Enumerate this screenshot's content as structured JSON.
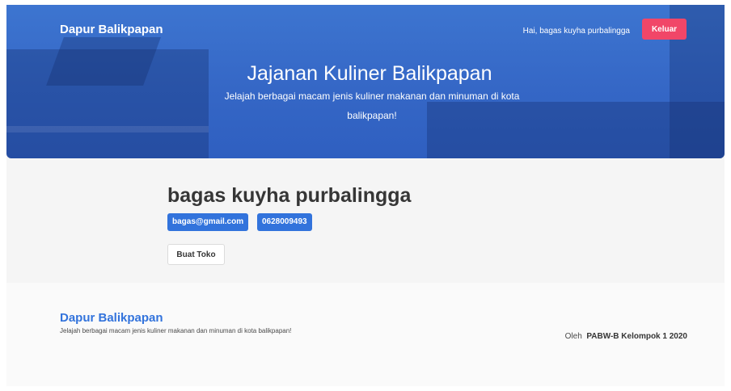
{
  "navbar": {
    "brand": "Dapur Balikpapan",
    "greeting": "Hai, bagas kuyha purbalingga",
    "logout_label": "Keluar"
  },
  "hero": {
    "title": "Jajanan Kuliner Balikpapan",
    "subtitle": "Jelajah berbagai macam jenis kuliner makanan dan minuman di kota balikpapan!"
  },
  "profile": {
    "name": "bagas kuyha purbalingga",
    "email": "bagas@gmail.com",
    "phone": "0628009493",
    "create_shop_label": "Buat Toko"
  },
  "footer": {
    "brand": "Dapur Balikpapan",
    "description": "Jelajah berbagai macam jenis kuliner makanan dan minuman di kota balikpapan!",
    "credit_prefix": "Oleh",
    "credit_name": "PABW-B Kelompok 1 2020"
  },
  "colors": {
    "primary": "#3273dc",
    "danger": "#f14668",
    "hero": "#3567c6"
  }
}
